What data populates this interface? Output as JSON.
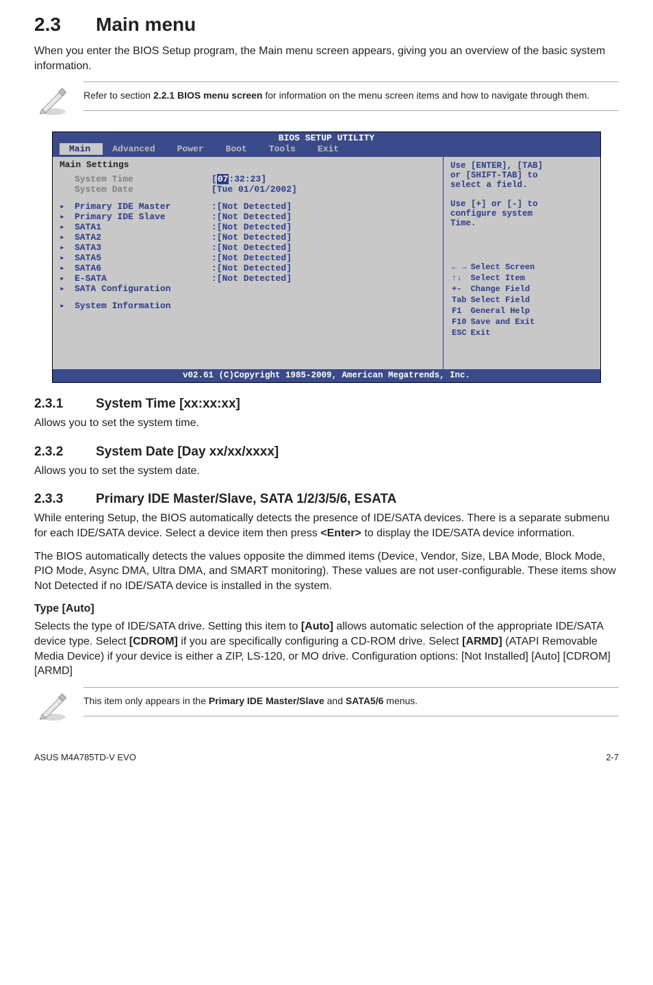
{
  "section": {
    "num": "2.3",
    "title": "Main menu"
  },
  "intro": "When you enter the BIOS Setup program, the Main menu screen appears, giving you an overview of the basic system information.",
  "note1_a": "Refer to section ",
  "note1_b": "2.2.1 BIOS menu screen",
  "note1_c": " for information on the menu screen items and how to navigate through them.",
  "bios": {
    "title": "BIOS SETUP UTILITY",
    "tabs": [
      "Main",
      "Advanced",
      "Power",
      "Boot",
      "Tools",
      "Exit"
    ],
    "heading": "Main Settings",
    "rows": [
      {
        "marker": "",
        "label": "System Time",
        "value_pre": "[",
        "hour": "07",
        "value_post": ":32:23]",
        "gray": true
      },
      {
        "marker": "",
        "label": "System Date",
        "value": "[Tue 01/01/2002]",
        "gray": true
      },
      {
        "spacer": true
      },
      {
        "marker": "▸",
        "label": "Primary IDE Master",
        "value": ":[Not Detected]"
      },
      {
        "marker": "▸",
        "label": "Primary IDE Slave",
        "value": ":[Not Detected]"
      },
      {
        "marker": "▸",
        "label": "SATA1",
        "value": ":[Not Detected]"
      },
      {
        "marker": "▸",
        "label": "SATA2",
        "value": ":[Not Detected]"
      },
      {
        "marker": "▸",
        "label": "SATA3",
        "value": ":[Not Detected]"
      },
      {
        "marker": "▸",
        "label": "SATA5",
        "value": ":[Not Detected]"
      },
      {
        "marker": "▸",
        "label": "SATA6",
        "value": ":[Not Detected]"
      },
      {
        "marker": "▸",
        "label": "E-SATA",
        "value": ":[Not Detected]"
      },
      {
        "marker": "▸",
        "label": "SATA Configuration",
        "value": ""
      },
      {
        "spacer": true
      },
      {
        "marker": "▸",
        "label": "System Information",
        "value": ""
      }
    ],
    "help": [
      "Use [ENTER], [TAB]",
      "or [SHIFT-TAB] to",
      "select a field.",
      "",
      "Use [+] or [-] to",
      "configure system",
      "Time."
    ],
    "nav": [
      {
        "k": "← →",
        "v": "Select Screen"
      },
      {
        "k": "↑↓",
        "v": "Select Item"
      },
      {
        "k": "+-",
        "v": "Change Field"
      },
      {
        "k": "Tab",
        "v": "Select Field"
      },
      {
        "k": "F1",
        "v": "General Help"
      },
      {
        "k": "F10",
        "v": "Save and Exit"
      },
      {
        "k": "ESC",
        "v": "Exit"
      }
    ],
    "footer": "v02.61 (C)Copyright 1985-2009, American Megatrends, Inc."
  },
  "s231": {
    "num": "2.3.1",
    "title": "System Time [xx:xx:xx]",
    "body": "Allows you to set the system time."
  },
  "s232": {
    "num": "2.3.2",
    "title": "System Date [Day xx/xx/xxxx]",
    "body": "Allows you to set the system date."
  },
  "s233": {
    "num": "2.3.3",
    "title": "Primary IDE Master/Slave, SATA 1/2/3/5/6, ESATA",
    "p1_a": "While entering Setup, the BIOS automatically detects the presence of IDE/SATA devices. There is a separate submenu for each IDE/SATA device. Select a device item then press ",
    "p1_b": "<Enter>",
    "p1_c": " to display the IDE/SATA device information.",
    "p2": "The BIOS automatically detects the values opposite the dimmed items (Device, Vendor, Size, LBA Mode, Block Mode, PIO Mode, Async DMA, Ultra DMA, and SMART monitoring). These values are not user-configurable. These items show Not Detected if no IDE/SATA device is installed in the system."
  },
  "type": {
    "title": "Type [Auto]",
    "a": "Selects the type of IDE/SATA drive. Setting this item to ",
    "b": "[Auto]",
    "c": " allows automatic selection of the appropriate IDE/SATA device type. Select ",
    "d": "[CDROM]",
    "e": " if you are specifically configuring a CD-ROM drive. Select ",
    "f": "[ARMD]",
    "g": " (ATAPI Removable Media Device) if your device is either a ZIP, LS-120, or MO drive. Configuration options: [Not Installed] [Auto] [CDROM] [ARMD]"
  },
  "note2_a": "This item only appears in the ",
  "note2_b": "Primary IDE Master/Slave",
  "note2_c": " and ",
  "note2_d": "SATA5/6",
  "note2_e": " menus.",
  "footer_left": "ASUS M4A785TD-V EVO",
  "footer_right": "2-7"
}
